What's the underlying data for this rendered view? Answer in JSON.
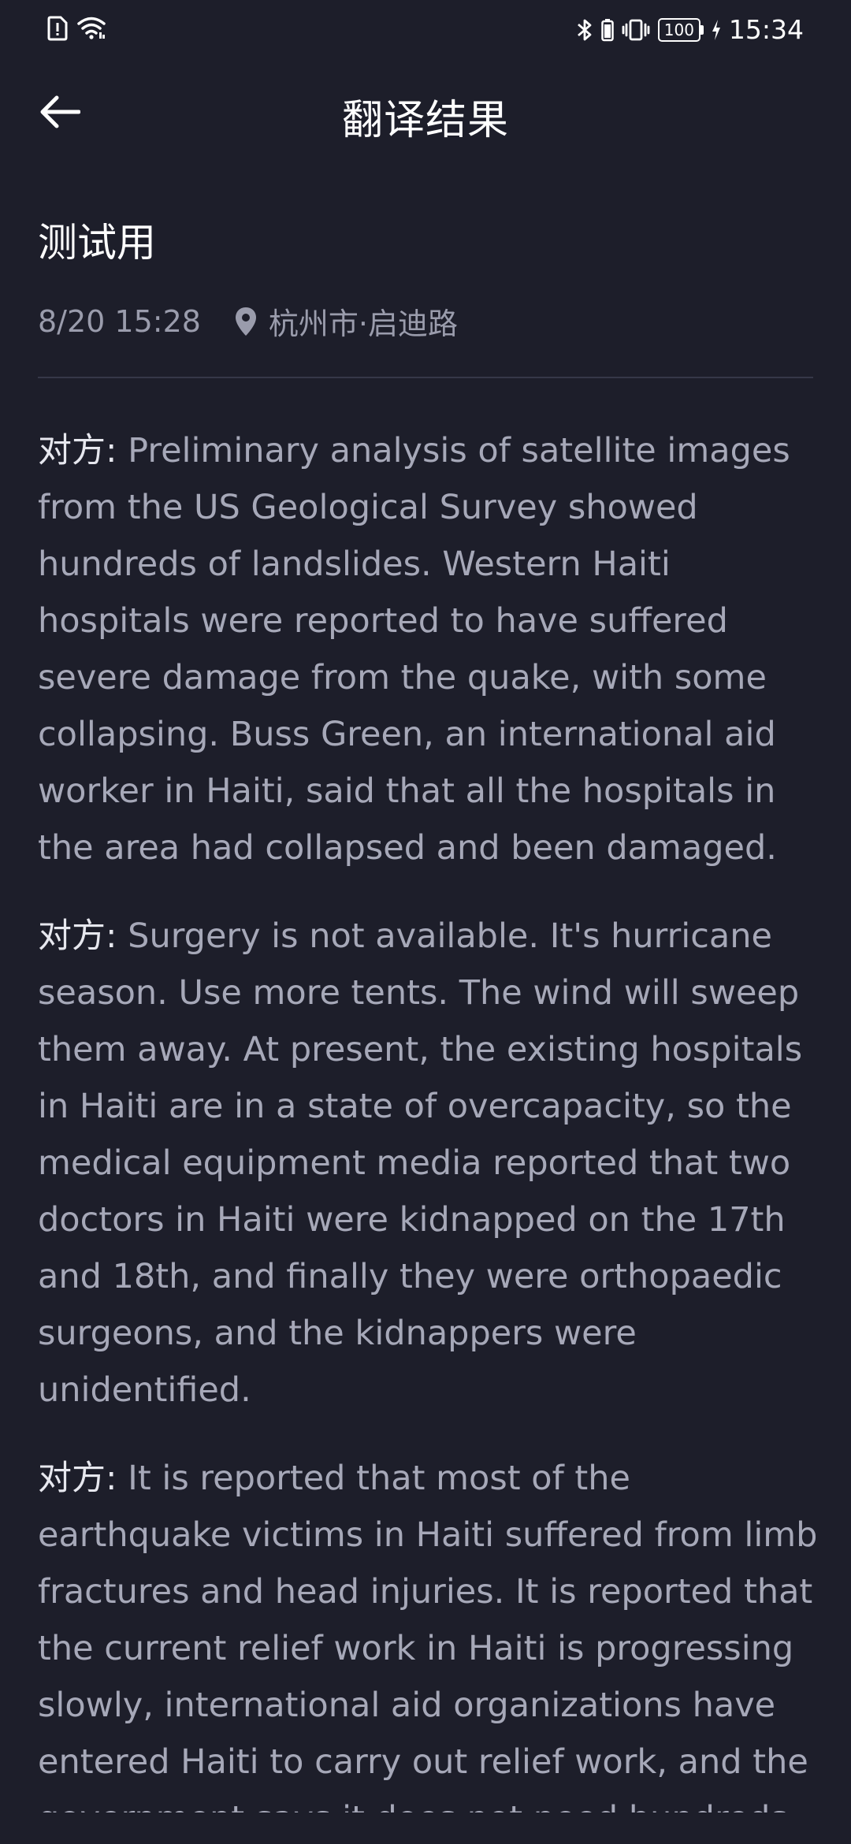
{
  "status_bar": {
    "time": "15:34",
    "battery": "100",
    "icons": [
      "sim-alert-icon",
      "wifi-icon",
      "bluetooth-icon",
      "vibrate-icon",
      "battery-icon",
      "charging-icon"
    ]
  },
  "header": {
    "title": "翻译结果",
    "back_icon": "back-arrow-icon"
  },
  "record": {
    "title": "测试用",
    "datetime": "8/20 15:28",
    "location": "杭州市·启迪路",
    "location_icon": "location-pin-icon"
  },
  "messages": [
    {
      "speaker": "对方:",
      "text": "Preliminary analysis of satellite images from the US Geological Survey showed hundreds of landslides. Western Haiti hospitals were reported to have suffered severe damage from the quake, with some collapsing. Buss Green, an international aid worker in Haiti, said that all the hospitals in the area had collapsed and been damaged."
    },
    {
      "speaker": "对方:",
      "text": "Surgery is not available. It's hurricane season. Use more tents. The wind will sweep them away. At present, the existing hospitals in Haiti are in a state of overcapacity, so the medical equipment media reported that two doctors in Haiti were kidnapped on the 17th and 18th, and finally they were orthopaedic surgeons, and the kidnappers were unidentified."
    },
    {
      "speaker": "对方:",
      "text": "It is reported that most of the earthquake victims in Haiti suffered from limb fractures and head injuries. It is reported that the current relief work in Haiti is progressing slowly, international aid organizations have entered Haiti to carry out relief work, and the government says it does not need hundreds"
    }
  ],
  "colors": {
    "background": "#1d1e2a",
    "primary_text": "#ffffff",
    "secondary_text": "#9a9cac",
    "body_text": "#a6a8b8",
    "divider": "#363848"
  }
}
